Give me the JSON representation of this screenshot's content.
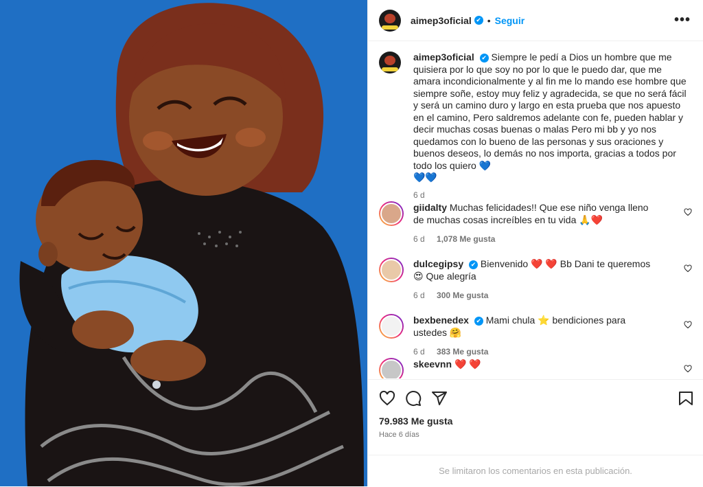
{
  "post": {
    "username": "aimep3oficial",
    "verified_mark": "✔",
    "follow_label": "Seguir",
    "more_label": "•••"
  },
  "caption": {
    "username": "aimep3oficial",
    "text": "Siempre le pedí a Dios un hombre que me quisiera por lo que soy no por lo que le puedo dar, que me amara incondicionalmente y al fin me lo mando ese hombre que siempre soñe, estoy muy feliz y agradecida, se que no será fácil y será un camino duro y largo en esta prueba que nos apuesto en el camino, Pero saldremos adelante con fe, pueden hablar y decir muchas cosas buenas o malas Pero mi bb y yo nos quedamos con lo bueno de las personas y sus oraciones y buenos deseos, lo demás no nos importa, gracias a todos por todo los quiero",
    "emoji_inline": "💙",
    "emoji_line": "💙💙",
    "time": "6 d"
  },
  "comments": [
    {
      "username": "giidalty",
      "verified": false,
      "text": "Muchas felicidades!! Que ese niño venga lleno de muchas cosas increíbles en tu vida 🙏❤️",
      "time": "6 d",
      "likes": "1,078 Me gusta"
    },
    {
      "username": "dulcegipsy",
      "verified": true,
      "text": "Bienvenido ❤️ ❤️ Bb Dani te queremos 😍 Que alegría",
      "time": "6 d",
      "likes": "300 Me gusta"
    },
    {
      "username": "bexbenedex",
      "verified": true,
      "text": "Mami chula ⭐ bendiciones para ustedes 🤗",
      "time": "6 d",
      "likes": "383 Me gusta"
    },
    {
      "username": "skeevnn",
      "verified": false,
      "text": "❤️ ❤️",
      "time": "",
      "likes": ""
    }
  ],
  "actions": {
    "like_icon": "heart-icon",
    "comment_icon": "comment-icon",
    "share_icon": "share-icon",
    "save_icon": "bookmark-icon"
  },
  "stats": {
    "likes": "79.983 Me gusta",
    "posted": "Hace 6 días"
  },
  "footer": {
    "limited_text": "Se limitaron los comentarios en esta publicación."
  },
  "colors": {
    "background_image": "#1f6fc4",
    "accent": "#0095f6"
  }
}
